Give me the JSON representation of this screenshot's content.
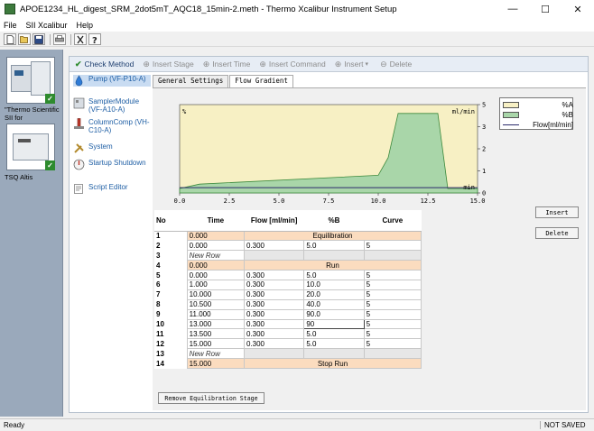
{
  "window": {
    "title": "APOE1234_HL_digest_SRM_2dot5mT_AQC18_15min-2.meth - Thermo Xcalibur Instrument Setup",
    "minimize_glyph": "—",
    "maximize_glyph": "☐",
    "close_glyph": "✕"
  },
  "menu": [
    "File",
    "SII Xcalibur",
    "Help"
  ],
  "toolbar_icons": [
    "new-icon",
    "open-icon",
    "save-icon",
    "print-icon",
    "cut-icon",
    "help-icon"
  ],
  "instruments": [
    {
      "label": "\"Thermo Scientific SII for",
      "icon": "lc-stack-icon"
    },
    {
      "label": "TSQ Altis",
      "icon": "mass-spec-icon"
    }
  ],
  "commands": {
    "check": "Check Method",
    "insert_stage": "Insert Stage",
    "insert_time": "Insert Time",
    "insert_command": "Insert Command",
    "insert": "Insert",
    "delete": "Delete"
  },
  "nav": [
    {
      "label": "Pump (VF-P10-A)",
      "icon": "pump-icon",
      "selected": true
    },
    {
      "label": "SamplerModule (VF-A10-A)",
      "icon": "sampler-icon",
      "selected": false
    },
    {
      "label": "ColumnComp (VH-C10-A)",
      "icon": "column-icon",
      "selected": false
    },
    {
      "label": "System",
      "icon": "tools-icon",
      "selected": false
    },
    {
      "label": "Startup Shutdown",
      "icon": "startup-icon",
      "selected": false
    },
    {
      "label": "Script Editor",
      "icon": "script-icon",
      "selected": false
    }
  ],
  "tabs": [
    "General Settings",
    "Flow Gradient"
  ],
  "active_tab": 1,
  "chart_data": {
    "type": "area",
    "x": [
      0.0,
      1.0,
      10.0,
      10.5,
      11.0,
      13.0,
      13.5,
      15.0
    ],
    "series": [
      {
        "name": "%A",
        "values": [
          95.0,
          90.0,
          80.0,
          60.0,
          10.0,
          10.0,
          95.0,
          95.0
        ],
        "color": "#f7f0c4"
      },
      {
        "name": "%B",
        "values": [
          5.0,
          10.0,
          20.0,
          40.0,
          90.0,
          90.0,
          5.0,
          5.0
        ],
        "color": "#a9d6a9"
      },
      {
        "name": "Flow[ml/min]",
        "values": [
          0.3,
          0.3,
          0.3,
          0.3,
          0.3,
          0.3,
          0.3,
          0.3
        ],
        "color": "#2b2b6b"
      }
    ],
    "xlim": [
      0,
      15
    ],
    "ylim_left": [
      0,
      100
    ],
    "ylim_right": [
      0,
      5
    ],
    "x_ticks": [
      "0.0",
      "2.5",
      "5.0",
      "7.5",
      "10.0",
      "12.5",
      "15.0"
    ],
    "right_ticks": [
      "5.00",
      "3.75",
      "2.50",
      "1.25",
      "0.00"
    ],
    "left_axis_label": "%",
    "right_axis_label": "ml/min",
    "x_axis_label": "min",
    "legend_position": "top-right"
  },
  "table": {
    "headers": [
      "No",
      "Time",
      "Flow [ml/min]",
      "%B",
      "Curve"
    ],
    "rows": [
      {
        "no": "1",
        "kind": "special",
        "time": "0.000",
        "label": "Equilibration"
      },
      {
        "no": "2",
        "kind": "data",
        "time": "0.000",
        "flow": "0.300",
        "pb": "5.0",
        "curve": "5"
      },
      {
        "no": "3",
        "kind": "newrow",
        "time": "New Row"
      },
      {
        "no": "4",
        "kind": "special",
        "time": "0.000",
        "label": "Run"
      },
      {
        "no": "5",
        "kind": "data",
        "time": "0.000",
        "flow": "0.300",
        "pb": "5.0",
        "curve": "5"
      },
      {
        "no": "6",
        "kind": "data",
        "time": "1.000",
        "flow": "0.300",
        "pb": "10.0",
        "curve": "5"
      },
      {
        "no": "7",
        "kind": "data",
        "time": "10.000",
        "flow": "0.300",
        "pb": "20.0",
        "curve": "5"
      },
      {
        "no": "8",
        "kind": "data",
        "time": "10.500",
        "flow": "0.300",
        "pb": "40.0",
        "curve": "5"
      },
      {
        "no": "9",
        "kind": "data",
        "time": "11.000",
        "flow": "0.300",
        "pb": "90.0",
        "curve": "5"
      },
      {
        "no": "10",
        "kind": "data",
        "time": "13.000",
        "flow": "0.300",
        "pb": "90",
        "curve": "5",
        "editing": true
      },
      {
        "no": "11",
        "kind": "data",
        "time": "13.500",
        "flow": "0.300",
        "pb": "5.0",
        "curve": "5"
      },
      {
        "no": "12",
        "kind": "data",
        "time": "15.000",
        "flow": "0.300",
        "pb": "5.0",
        "curve": "5"
      },
      {
        "no": "13",
        "kind": "newrow",
        "time": "New Row"
      },
      {
        "no": "14",
        "kind": "special",
        "time": "15.000",
        "label": "Stop Run"
      }
    ]
  },
  "buttons": {
    "insert": "Insert",
    "delete": "Delete",
    "remove_equilibration": "Remove Equilibration Stage"
  },
  "status": {
    "left": "Ready",
    "right": "NOT SAVED"
  }
}
